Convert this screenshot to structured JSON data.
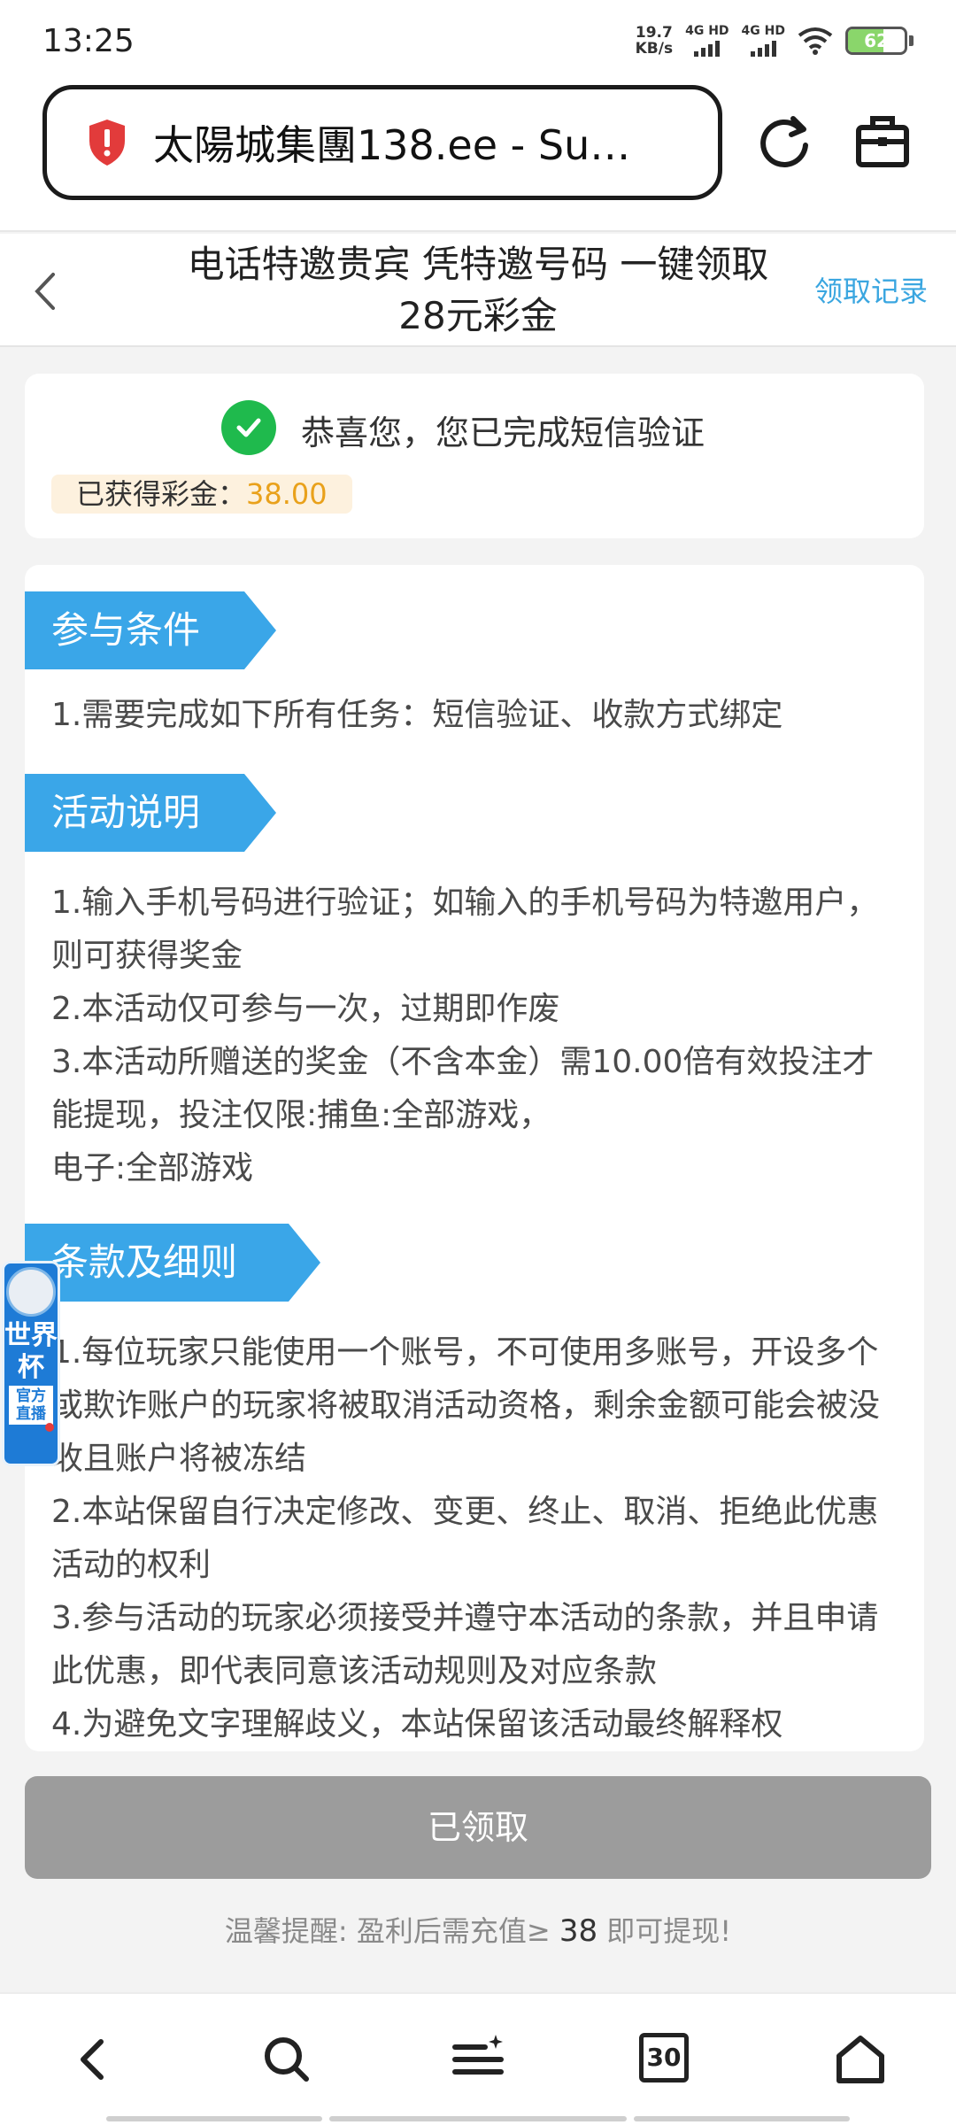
{
  "status_bar": {
    "time": "13:25",
    "speed_value": "19.7",
    "speed_unit": "KB/s",
    "sim1": "4G HD",
    "sim2": "4G HD",
    "battery": "62"
  },
  "browser": {
    "url": "太陽城集團138.ee - Su…",
    "icons": [
      "security-warning-shield-icon",
      "reload-icon",
      "toolbox-icon"
    ]
  },
  "header": {
    "title": "电话特邀贵宾 凭特邀号码 一键领取28元彩金",
    "records_link": "领取记录"
  },
  "success": {
    "message": "恭喜您，您已完成短信验证",
    "bonus_label": "已获得彩金：",
    "bonus_amount": "38.00"
  },
  "sections": {
    "conditions": {
      "title": "参与条件",
      "lines": [
        "1.需要完成如下所有任务：短信验证、收款方式绑定"
      ]
    },
    "description": {
      "title": "活动说明",
      "lines": [
        "1.输入手机号码进行验证；如输入的手机号码为特邀用户，则可获得奖金",
        "2.本活动仅可参与一次，过期即作废",
        "3.本活动所赠送的奖金（不含本金）需10.00倍有效投注才能提现，投注仅限:捕鱼:全部游戏，",
        "电子:全部游戏"
      ]
    },
    "terms": {
      "title": "条款及细则",
      "lines": [
        "1.每位玩家只能使用一个账号，不可使用多账号，开设多个或欺诈账户的玩家将被取消活动资格，剩余金额可能会被没收且账户将被冻结",
        "2.本站保留自行决定修改、变更、终止、取消、拒绝此优惠活动的权利",
        "3.参与活动的玩家必须接受并遵守本活动的条款，并且申请此优惠，即代表同意该活动规则及对应条款",
        "4.为避免文字理解歧义，本站保留该活动最终解释权"
      ]
    }
  },
  "floating_badge": {
    "line1": "世界杯",
    "line2": "官方",
    "line3": "直播"
  },
  "bottom": {
    "claim_button": "已领取",
    "reminder_prefix": "温馨提醒: 盈利后需充值≥",
    "reminder_amount": "38",
    "reminder_suffix": "即可提现!"
  },
  "bottom_nav": {
    "tab_count": "30",
    "icons": [
      "back-icon",
      "search-icon",
      "menu-icon",
      "tabs-icon",
      "home-icon"
    ]
  },
  "colors": {
    "accent_blue": "#3aa6e8",
    "success_green": "#1fba4d",
    "bonus_orange": "#e9a11b",
    "disabled_gray": "#9c9c9c"
  }
}
